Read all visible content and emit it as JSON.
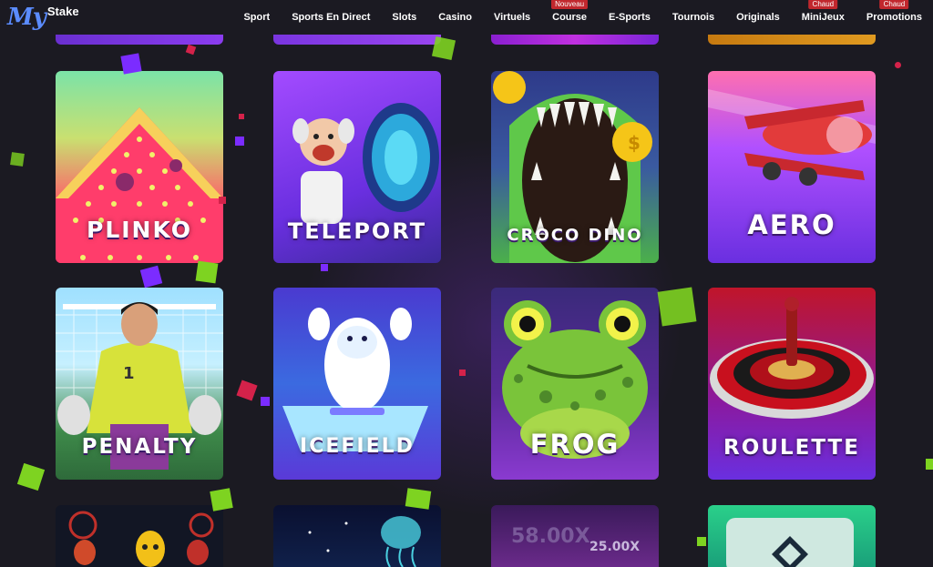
{
  "brand": {
    "logo_my": "My",
    "logo_stake": "Stake"
  },
  "nav": [
    {
      "label": "Sport",
      "badge": ""
    },
    {
      "label": "Sports En Direct",
      "badge": ""
    },
    {
      "label": "Slots",
      "badge": ""
    },
    {
      "label": "Casino",
      "badge": ""
    },
    {
      "label": "Virtuels",
      "badge": ""
    },
    {
      "label": "Course",
      "badge": "Nouveau"
    },
    {
      "label": "E-Sports",
      "badge": ""
    },
    {
      "label": "Tournois",
      "badge": ""
    },
    {
      "label": "Originals",
      "badge": ""
    },
    {
      "label": "MiniJeux",
      "badge": "Chaud"
    },
    {
      "label": "Promotions",
      "badge": "Chaud"
    }
  ],
  "games": [
    {
      "title": "PLINKO"
    },
    {
      "title": "TELEPORT"
    },
    {
      "title": "CROCO DINO"
    },
    {
      "title": "AERO"
    },
    {
      "title": "PENALTY"
    },
    {
      "title": "ICEFIELD"
    },
    {
      "title": "FROG"
    },
    {
      "title": "ROULETTE"
    }
  ],
  "partial_games": {
    "crash_multiplier_1": "58.00X",
    "crash_multiplier_2": "25.00X"
  },
  "colors": {
    "background": "#1b1a22",
    "brand_blue": "#5b8cff",
    "badge_red": "#c1272d",
    "confetti_green": "#7ed321",
    "confetti_purple": "#7b2cff"
  }
}
